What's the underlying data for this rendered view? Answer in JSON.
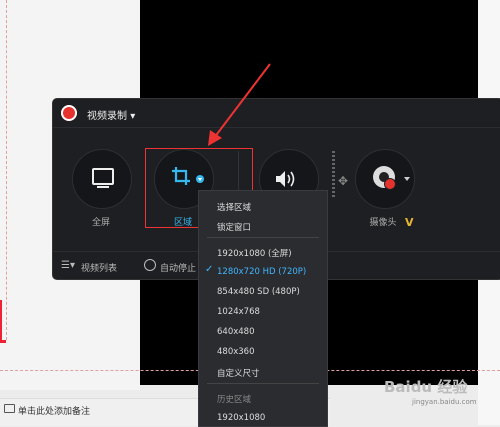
{
  "recorder": {
    "title": "视频录制",
    "modes": [
      {
        "label": "全屏"
      },
      {
        "label": "区域"
      },
      {
        "label": "摄像头"
      }
    ],
    "bottom": {
      "video_list": "视频列表",
      "auto_stop": "自动停止 ("
    }
  },
  "dropdown": {
    "items": [
      "选择区域",
      "锁定窗口",
      "1920x1080 (全屏)",
      "1280x720 HD (720P)",
      "854x480 SD (480P)",
      "1024x768",
      "640x480",
      "480x360",
      "自定义尺寸",
      "历史区域",
      "1920x1080"
    ],
    "selected": "1280x720 HD (720P)"
  },
  "note": {
    "text": "单击此处添加备注"
  },
  "watermark": {
    "text": "Baidu 经验",
    "sub": "jingyan.baidu.com"
  },
  "colors": {
    "accent": "#3fb6ff",
    "brand_red": "#e5322d",
    "highlight": "#ee3333"
  }
}
